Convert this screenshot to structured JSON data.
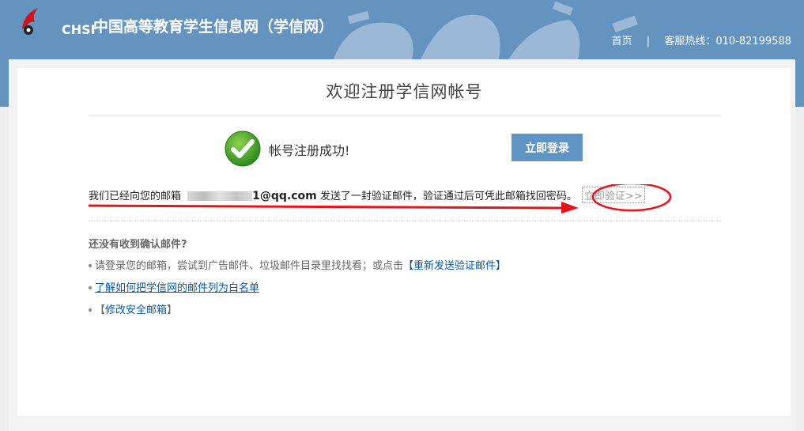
{
  "header": {
    "logo_text": "CHSI",
    "site_title": "中国高等教育学生信息网（学信网）",
    "nav": {
      "home": "首页",
      "separator": "|",
      "hotline": "客服热线：010-82199588"
    }
  },
  "main": {
    "page_title": "欢迎注册学信网帐号",
    "success_message": "帐号注册成功!",
    "login_button": "立即登录",
    "mail_prefix": "我们已经向您的邮箱",
    "email_visible": "1@qq.com",
    "mail_suffix": "发送了一封验证邮件，验证通过后可凭此邮箱找回密码。",
    "verify_link": "立即验证>>",
    "question_title": "还没有收到确认邮件?",
    "tips": {
      "tip1_text": "请登录您的邮箱，尝试到广告邮件、垃圾邮件目录里找找看；或点击",
      "tip1_link": "【重新发送验证邮件】",
      "tip2_link": "了解如何把学信网的邮件列为白名单",
      "tip3_open": "【",
      "tip3_link": "修改安全邮箱",
      "tip3_close": "】"
    }
  },
  "colors": {
    "header_bg": "#6593c0",
    "button_bg": "#5f94c4",
    "link": "#0b5697",
    "annotation_red": "#e4141b"
  }
}
